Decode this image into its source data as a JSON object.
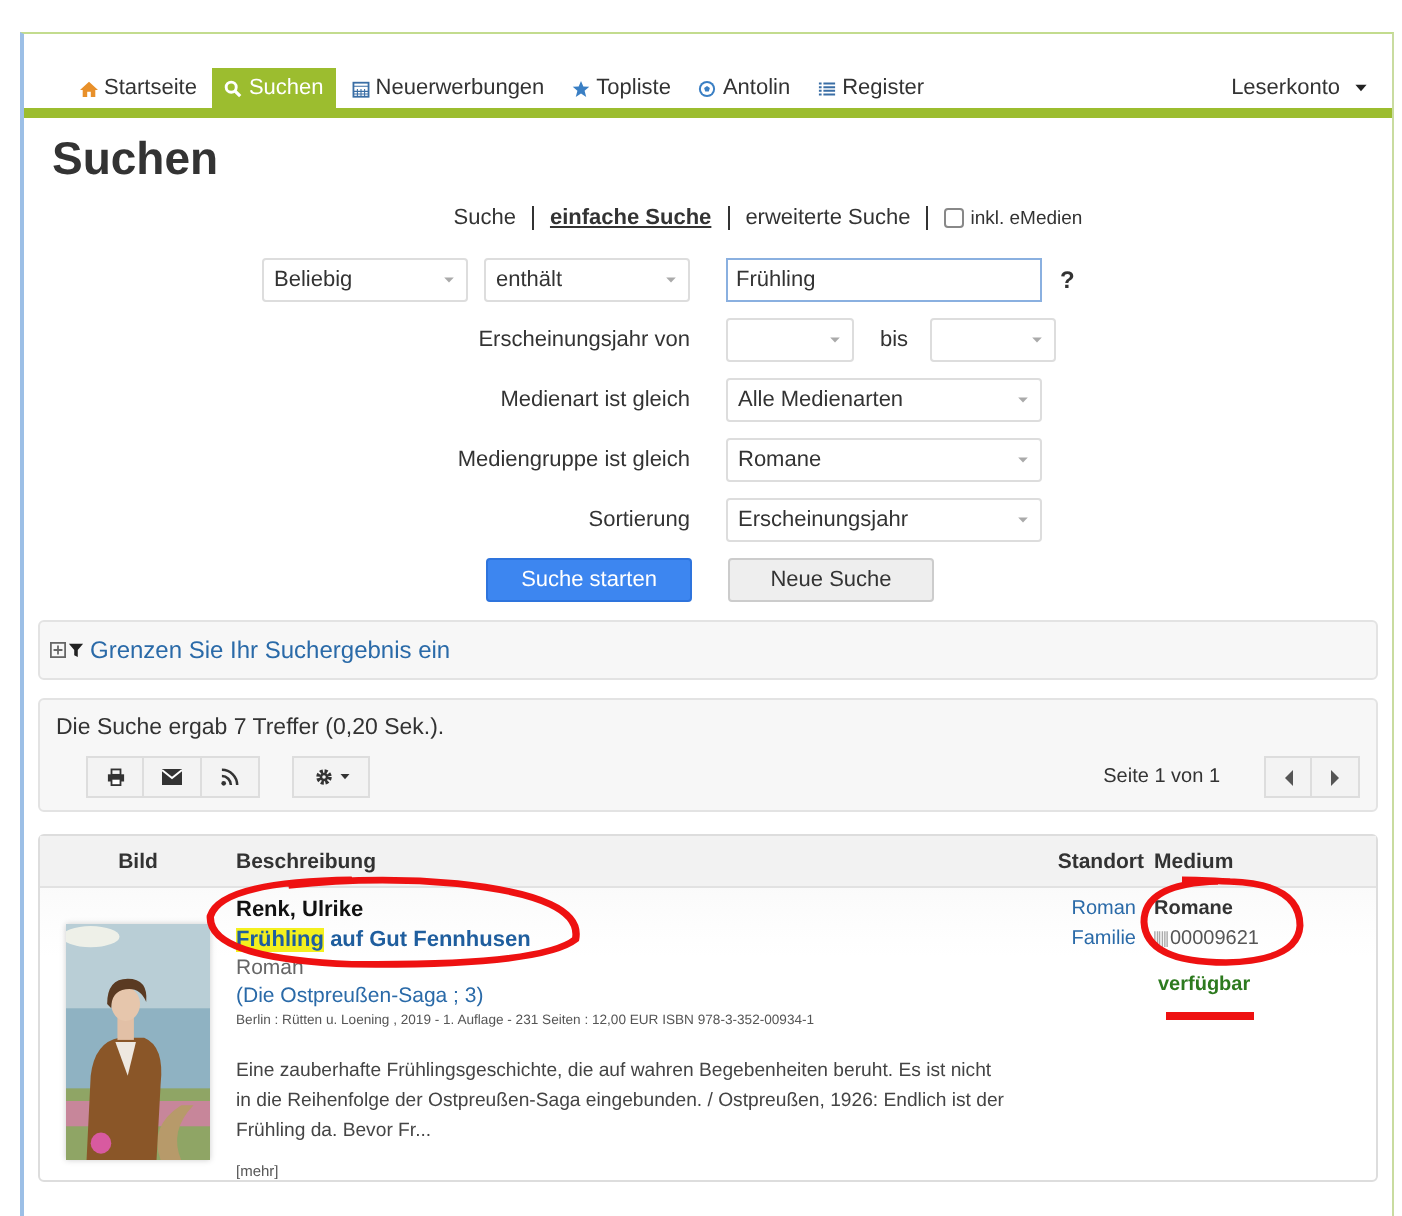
{
  "nav": {
    "items": [
      {
        "label": "Startseite",
        "selected": false
      },
      {
        "label": "Suchen",
        "selected": true
      },
      {
        "label": "Neuerwerbungen",
        "selected": false
      },
      {
        "label": "Topliste",
        "selected": false
      },
      {
        "label": "Antolin",
        "selected": false
      },
      {
        "label": "Register",
        "selected": false
      }
    ],
    "account": "Leserkonto"
  },
  "title": "Suchen",
  "modes": [
    {
      "label": "Suche",
      "selected": false
    },
    {
      "label": "einfache Suche",
      "selected": true
    },
    {
      "label": "erweiterte Suche",
      "selected": false
    }
  ],
  "emedien": {
    "label": "inkl. eMedien",
    "checked": false
  },
  "query": {
    "field": "Beliebig",
    "operator": "enthält",
    "value": "Frühling",
    "help": "?"
  },
  "filters": [
    {
      "kind": "range",
      "label": "Erscheinungsjahr von",
      "to_label": "bis"
    },
    {
      "kind": "select",
      "label": "Medienart ist gleich",
      "value": "Alle Medienarten"
    },
    {
      "kind": "select",
      "label": "Mediengruppe ist gleich",
      "value": "Romane"
    },
    {
      "kind": "select",
      "label": "Sortierung",
      "value": "Erscheinungsjahr"
    }
  ],
  "buttons": {
    "search": "Suche starten",
    "reset": "Neue Suche"
  },
  "refine": "Grenzen Sie Ihr Suchergebnis ein",
  "summary": "Die Suche ergab 7 Treffer (0,20 Sek.).",
  "pager": "Seite 1 von 1",
  "table": {
    "columns": [
      "Bild",
      "Beschreibung",
      "Standort",
      "Medium"
    ],
    "rows": [
      {
        "author": "Renk, Ulrike",
        "title": [
          {
            "text": "Frühling",
            "highlight": true
          },
          {
            "text": "auf Gut Fennhusen",
            "highlight": false
          }
        ],
        "subtitle": "Roman",
        "series": "(Die Ostpreußen-Saga ; 3)",
        "imprint": "Berlin : Rütten u. Loening , 2019 - 1. Auflage - 231 Seiten : 12,00 EUR ISBN 978-3-352-00934-1",
        "abstract": "Eine zauberhafte Frühlingsgeschichte, die auf wahren Begebenheiten beruht. Es ist nicht in die Reihenfolge der Ostpreußen-Saga eingebunden. / Ostpreußen, 1926: Endlich ist der Frühling da. Bevor Fr...",
        "more": "[mehr]",
        "location": [
          "Roman",
          "Familie"
        ],
        "medium": "Romane",
        "barcode": "00009621",
        "status": "verfügbar"
      }
    ]
  },
  "annotations": [
    {
      "kind": "loop"
    },
    {
      "kind": "loop"
    },
    {
      "kind": "underline"
    }
  ]
}
